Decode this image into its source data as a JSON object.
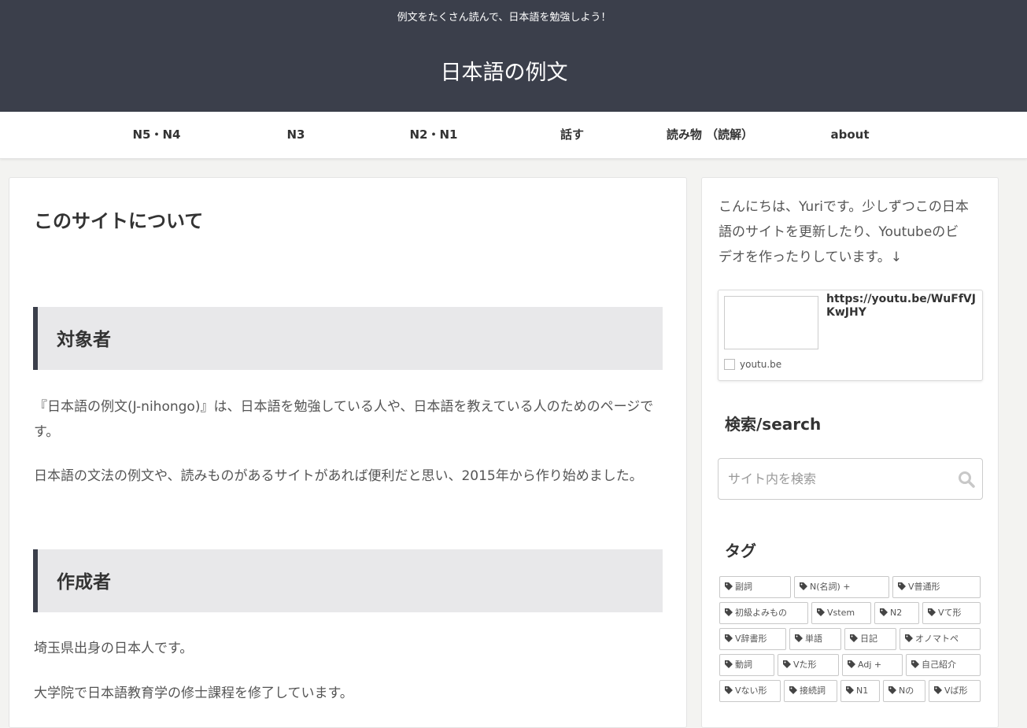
{
  "header": {
    "tagline": "例文をたくさん読んで、日本語を勉強しよう！",
    "title": "日本語の例文"
  },
  "nav": {
    "items": [
      "N5・N4",
      "N3",
      "N2・N1",
      "話す",
      "読み物 （読解）",
      "about"
    ]
  },
  "main": {
    "title": "このサイトについて",
    "section1": {
      "heading": "対象者",
      "p1": "『日本語の例文(J-nihongo)』は、日本語を勉強している人や、日本語を教えている人のためのページです。",
      "p2": "日本語の文法の例文や、読みものがあるサイトがあれば便利だと思い、2015年から作り始めました。"
    },
    "section2": {
      "heading": "作成者",
      "p1": "埼玉県出身の日本人です。",
      "p2": "大学院で日本語教育学の修士課程を修了しています。"
    }
  },
  "sidebar": {
    "intro": "こんにちは、Yuriです。少しずつこの日本語のサイトを更新したり、Youtubeのビデオを作ったりしています。↓",
    "youtube_card": {
      "link": "https://youtu.be/WuFfVJKwJHY",
      "domain": "youtu.be"
    },
    "search": {
      "heading": "検索/search",
      "placeholder": "サイト内を検索"
    },
    "tags": {
      "heading": "タグ",
      "items": [
        "副詞",
        "N(名詞) +",
        "V普通形",
        "初級よみもの",
        "Vstem",
        "N2",
        "Vて形",
        "V辞書形",
        "単語",
        "日記",
        "オノマトペ",
        "動詞",
        "Vた形",
        "Adj +",
        "自己紹介",
        "Vない形",
        "接続詞",
        "N1",
        "Nの",
        "Vば形"
      ]
    }
  },
  "colors": {
    "header_bg": "#3b3f4b",
    "heading_box_bg": "#e8e8ea",
    "page_bg": "#f3f3f1"
  }
}
